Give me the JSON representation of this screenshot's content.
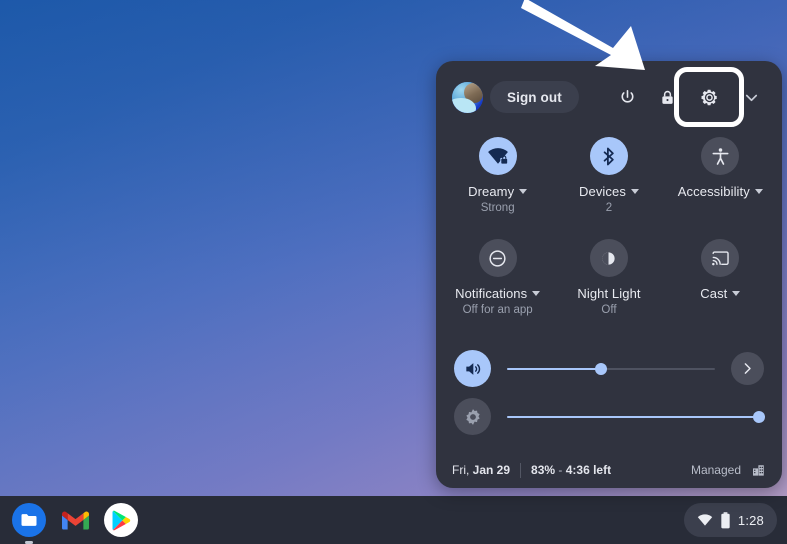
{
  "desktop": {
    "wallpaper_colors": [
      "#1f5fb0",
      "#4a6ec0",
      "#8f83c4",
      "#b79ec4"
    ]
  },
  "annotation": {
    "arrow_name": "pointer-arrow",
    "color": "#ffffff",
    "points_to": "settings-button"
  },
  "quick_settings": {
    "header": {
      "avatar_name": "user-avatar",
      "sign_out_label": "Sign out",
      "power_icon": "power-icon",
      "lock_icon": "lock-icon",
      "settings_icon": "gear-icon",
      "collapse_icon": "chevron-down-icon",
      "highlight_color": "#ffffff",
      "highlighted_element": "settings-button"
    },
    "tiles": [
      {
        "name": "network",
        "icon": "wifi-locked-icon",
        "label": "Dreamy",
        "sublabel": "Strong",
        "has_caret": true,
        "active": true
      },
      {
        "name": "bluetooth",
        "icon": "bluetooth-icon",
        "label": "Devices",
        "sublabel": "2",
        "has_caret": true,
        "active": true
      },
      {
        "name": "accessibility",
        "icon": "accessibility-icon",
        "label": "Accessibility",
        "sublabel": "",
        "has_caret": true,
        "active": false
      },
      {
        "name": "notifications",
        "icon": "do-not-disturb-icon",
        "label": "Notifications",
        "sublabel": "Off for an app",
        "has_caret": true,
        "active": false
      },
      {
        "name": "night-light",
        "icon": "night-light-icon",
        "label": "Night Light",
        "sublabel": "Off",
        "has_caret": false,
        "active": false
      },
      {
        "name": "cast",
        "icon": "cast-icon",
        "label": "Cast",
        "sublabel": "",
        "has_caret": true,
        "active": false
      }
    ],
    "sliders": [
      {
        "name": "volume",
        "icon": "volume-up-icon",
        "value": 45,
        "expand_icon": "chevron-right-icon"
      },
      {
        "name": "brightness",
        "icon": "brightness-icon",
        "value": 98,
        "expand_icon": ""
      }
    ],
    "footer": {
      "date": "Fri, Jan 29",
      "date_prefix": "Fri, ",
      "date_bold": "Jan 29",
      "battery_percent": "83%",
      "battery_sep": " - ",
      "battery_time": "4:36 left",
      "managed_label": "Managed",
      "managed_icon": "enterprise-building-icon"
    }
  },
  "shelf": {
    "apps": [
      {
        "name": "files-app",
        "label": "Files",
        "running": true
      },
      {
        "name": "gmail-app",
        "label": "Gmail",
        "running": false
      },
      {
        "name": "play-store-app",
        "label": "Play Store",
        "running": false
      }
    ],
    "tray": {
      "wifi_icon": "wifi-icon",
      "battery_icon": "battery-icon",
      "time": "1:28"
    }
  }
}
